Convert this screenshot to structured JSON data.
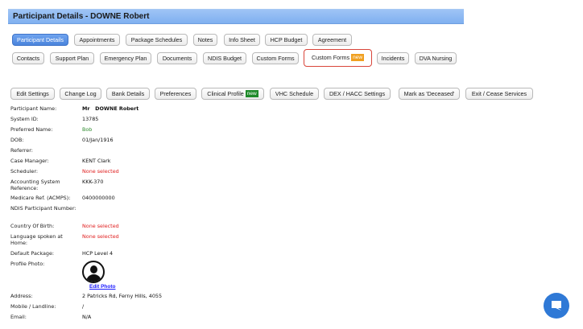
{
  "header": {
    "title": "Participant Details - DOWNE Robert"
  },
  "tabs_row1": [
    "Participant Details",
    "Appointments",
    "Package Schedules",
    "Notes",
    "Info Sheet",
    "HCP Budget",
    "Agreement"
  ],
  "tabs_row2": [
    "Contacts",
    "Support Plan",
    "Emergency Plan",
    "Documents",
    "NDIS Budget",
    "Custom Forms",
    "Custom Forms",
    "Incidents",
    "DVA Nursing"
  ],
  "new_badge": "new",
  "actions": [
    "Edit Settings",
    "Change Log",
    "Bank Details",
    "Preferences",
    "Clinical Profile",
    "VHC Schedule",
    "DEX / HACC Settings",
    "Mark as 'Deceased'",
    "Exit / Cease Services"
  ],
  "details": {
    "participant_name": {
      "label": "Participant Name:",
      "value": "Mr   DOWNE Robert"
    },
    "system_id": {
      "label": "System ID:",
      "value": "13785"
    },
    "preferred_name": {
      "label": "Preferred Name:",
      "value": "Bob"
    },
    "dob": {
      "label": "DOB:",
      "value": "01/Jan/1916"
    },
    "referrer": {
      "label": "Referrer:",
      "value": ""
    },
    "case_manager": {
      "label": "Case Manager:",
      "value": "KENT Clark"
    },
    "scheduler": {
      "label": "Scheduler:",
      "value": "None selected"
    },
    "accounting_ref": {
      "label": "Accounting System Reference:",
      "value": "KKK-370"
    },
    "medicare_ref": {
      "label": "Medicare Ref. (ACMPS):",
      "value": "0400000000"
    },
    "ndis_number": {
      "label": "NDIS Participant Number:",
      "value": ""
    },
    "country_of_birth": {
      "label": "Country Of Birth:",
      "value": "None selected"
    },
    "language": {
      "label": "Language spoken at Home:",
      "value": "None selected"
    },
    "default_package": {
      "label": "Default Package:",
      "value": "HCP Level 4"
    },
    "profile_photo": {
      "label": "Profile Photo:",
      "edit_label": "Edit Photo"
    },
    "address": {
      "label": "Address:",
      "value": "2 Patricks Rd, Ferny Hills, 4055"
    },
    "mobile": {
      "label": "Mobile / Landline:",
      "value": "/"
    },
    "email": {
      "label": "Email:",
      "value": "N/A"
    }
  },
  "colors": {
    "title_bar": "#8fbaf3",
    "active_tab": "#5a90e3",
    "highlight_border": "#d9453a",
    "new_badge_orange": "#f0a020",
    "new_badge_green": "#1f8a2a",
    "warning_text": "#e02020",
    "preferred_name_text": "#2d8a2d",
    "chat_button": "#2f79d6"
  },
  "icons": {
    "avatar": "user-avatar-icon",
    "chat": "chat-bubble-icon"
  }
}
